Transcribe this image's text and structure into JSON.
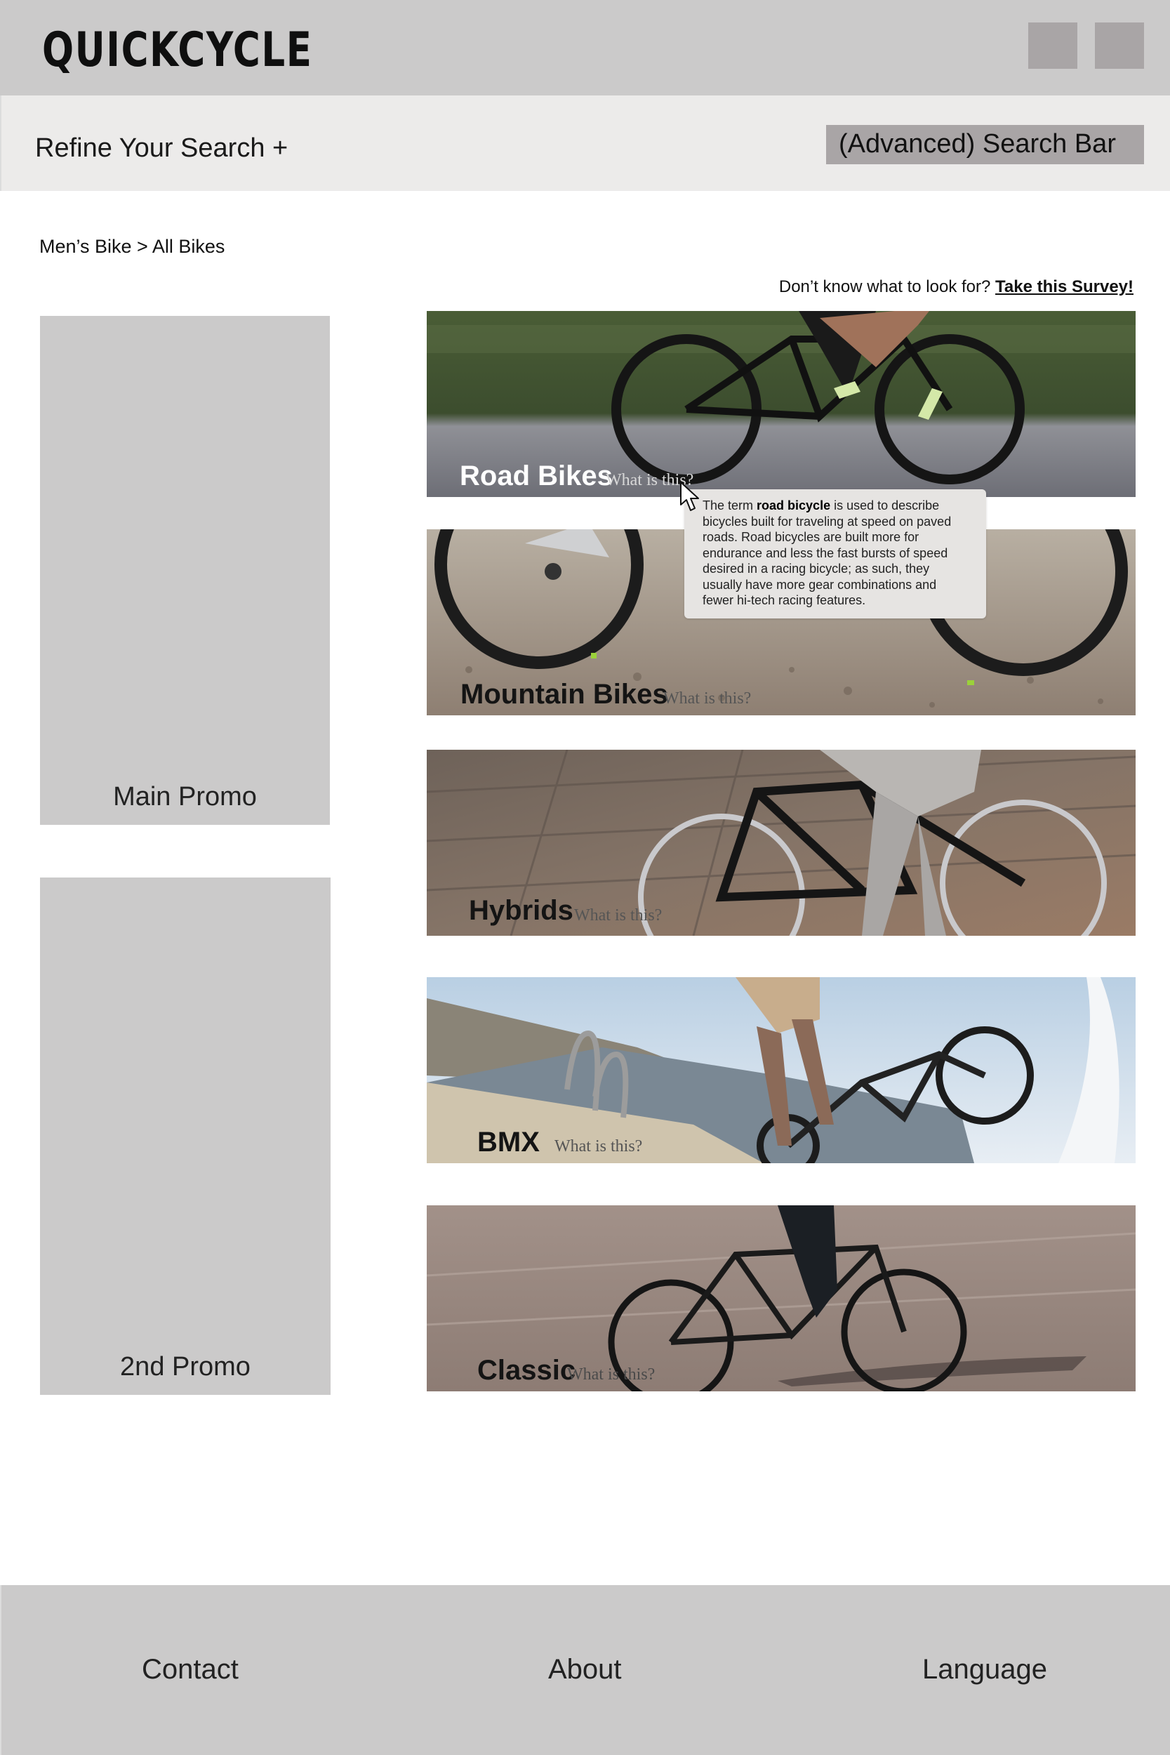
{
  "header": {
    "logo": "QUICKCYCLE",
    "icon_buttons": [
      "account-icon",
      "cart-icon"
    ]
  },
  "refine": {
    "label": "Refine Your Search +",
    "search_bar": "(Advanced) Search Bar"
  },
  "breadcrumb": "Men’s Bike > All Bikes",
  "survey": {
    "prompt": "Don’t know what to look for?",
    "link": "Take this Survey!"
  },
  "promos": {
    "main": "Main Promo",
    "second": "2nd Promo"
  },
  "categories": [
    {
      "title": "Road Bikes",
      "help": "What is this?"
    },
    {
      "title": "Mountain Bikes",
      "help": "What is this?"
    },
    {
      "title": "Hybrids",
      "help": "What is this?"
    },
    {
      "title": "BMX",
      "help": "What is this?"
    },
    {
      "title": "Classic",
      "help": "What is this?"
    }
  ],
  "tooltip": {
    "before": "The term ",
    "term": "road bicycle",
    "after": " is used to describe bicycles built for traveling at speed on paved roads. Road bicycles are built more for endurance and less the fast bursts of speed desired in a racing bicycle; as such, they usually have more gear combinations and fewer hi-tech racing features."
  },
  "footer": {
    "contact": "Contact",
    "about": "About",
    "language": "Language"
  },
  "colors": {
    "header_bg": "#cbcaca",
    "refine_bg": "#ecebea",
    "button_gray": "#a9a5a6",
    "promo_bg": "#cbcaca",
    "tooltip_bg": "#e6e4e2"
  }
}
